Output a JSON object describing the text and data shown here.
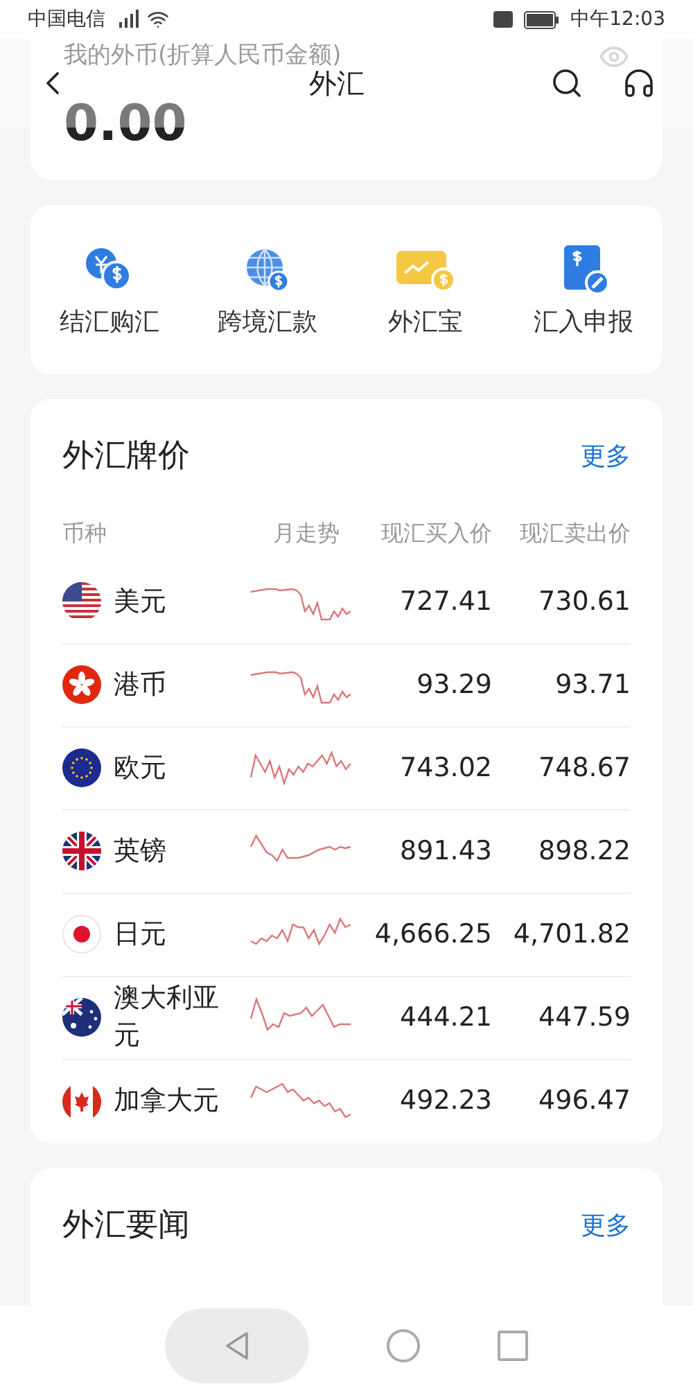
{
  "status_bar": {
    "carrier": "中国电信",
    "time": "中午12:03"
  },
  "header": {
    "title": "外汇"
  },
  "balance": {
    "label": "我的外币(折算人民币金额)",
    "value": "0.00"
  },
  "quick_actions": [
    {
      "label": "结汇购汇"
    },
    {
      "label": "跨境汇款"
    },
    {
      "label": "外汇宝"
    },
    {
      "label": "汇入申报"
    }
  ],
  "rates": {
    "title": "外汇牌价",
    "more": "更多",
    "columns": [
      "币种",
      "月走势",
      "现汇买入价",
      "现汇卖出价"
    ],
    "rows": [
      {
        "currency": "美元",
        "buy": "727.41",
        "sell": "730.61"
      },
      {
        "currency": "港币",
        "buy": "93.29",
        "sell": "93.71"
      },
      {
        "currency": "欧元",
        "buy": "743.02",
        "sell": "748.67"
      },
      {
        "currency": "英镑",
        "buy": "891.43",
        "sell": "898.22"
      },
      {
        "currency": "日元",
        "buy": "4,666.25",
        "sell": "4,701.82"
      },
      {
        "currency": "澳大利亚元",
        "buy": "444.21",
        "sell": "447.59"
      },
      {
        "currency": "加拿大元",
        "buy": "492.23",
        "sell": "496.47"
      }
    ]
  },
  "news": {
    "title": "外汇要闻",
    "more": "更多"
  }
}
